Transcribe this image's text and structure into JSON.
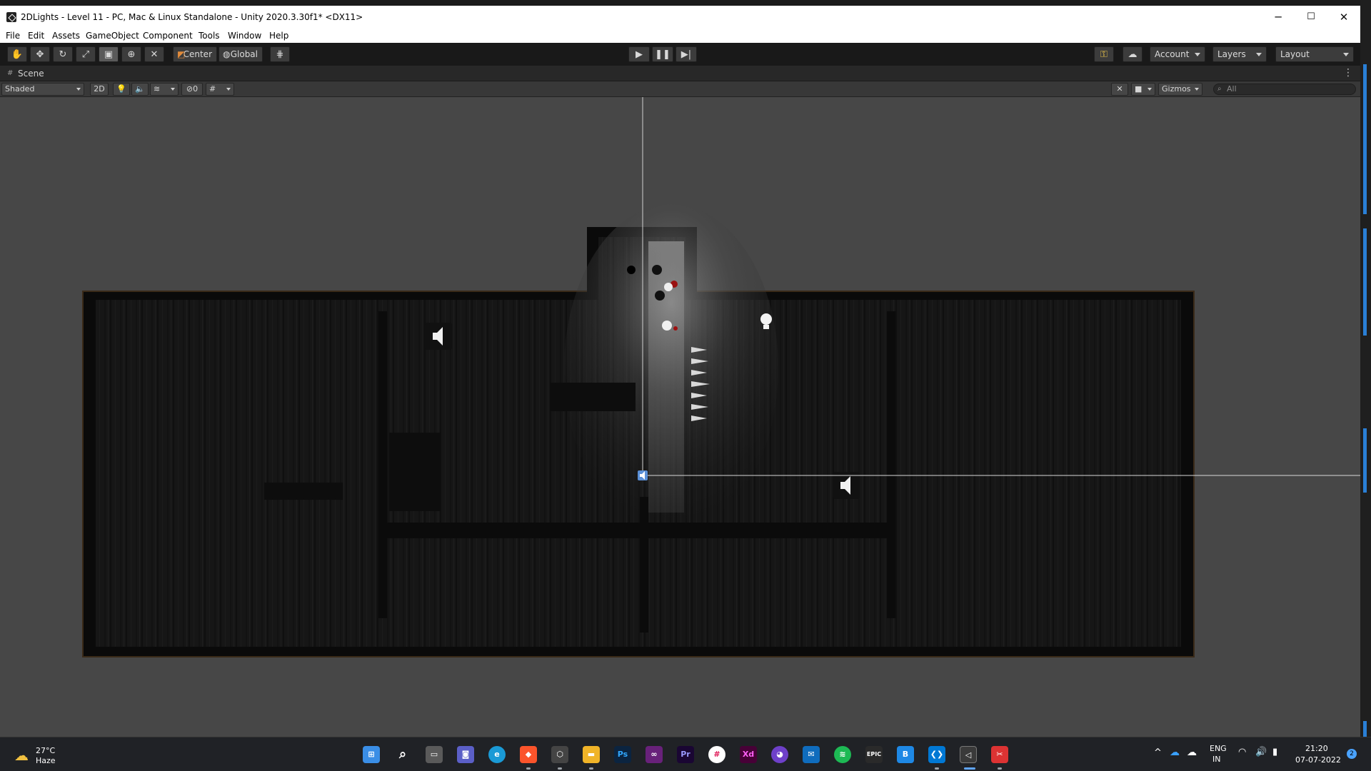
{
  "window": {
    "title": "2DLights - Level 11 - PC, Mac & Linux Standalone - Unity 2020.3.30f1* <DX11>",
    "controls": {
      "minimize": "─",
      "maximize": "☐",
      "close": "✕"
    }
  },
  "menu": [
    "File",
    "Edit",
    "Assets",
    "GameObject",
    "Component",
    "Tools",
    "Window",
    "Help"
  ],
  "toolbar": {
    "pivot_label": "Center",
    "space_label": "Global",
    "account_label": "Account",
    "layers_label": "Layers",
    "layout_label": "Layout"
  },
  "scene_tab": {
    "label": "Scene"
  },
  "scene_bar": {
    "draw_mode": "Shaded",
    "mode_2d": "2D",
    "hidden_count": "0",
    "gizmos_label": "Gizmos",
    "search_placeholder": "All"
  },
  "taskbar": {
    "weather_temp": "27°C",
    "weather_cond": "Haze",
    "lang_top": "ENG",
    "lang_bottom": "IN",
    "time": "21:20",
    "date": "07-07-2022",
    "notifications": "2"
  },
  "colors": {
    "accent": "#2a7fd6",
    "scene_bg": "#474747",
    "toolbar_bg": "#191919"
  }
}
